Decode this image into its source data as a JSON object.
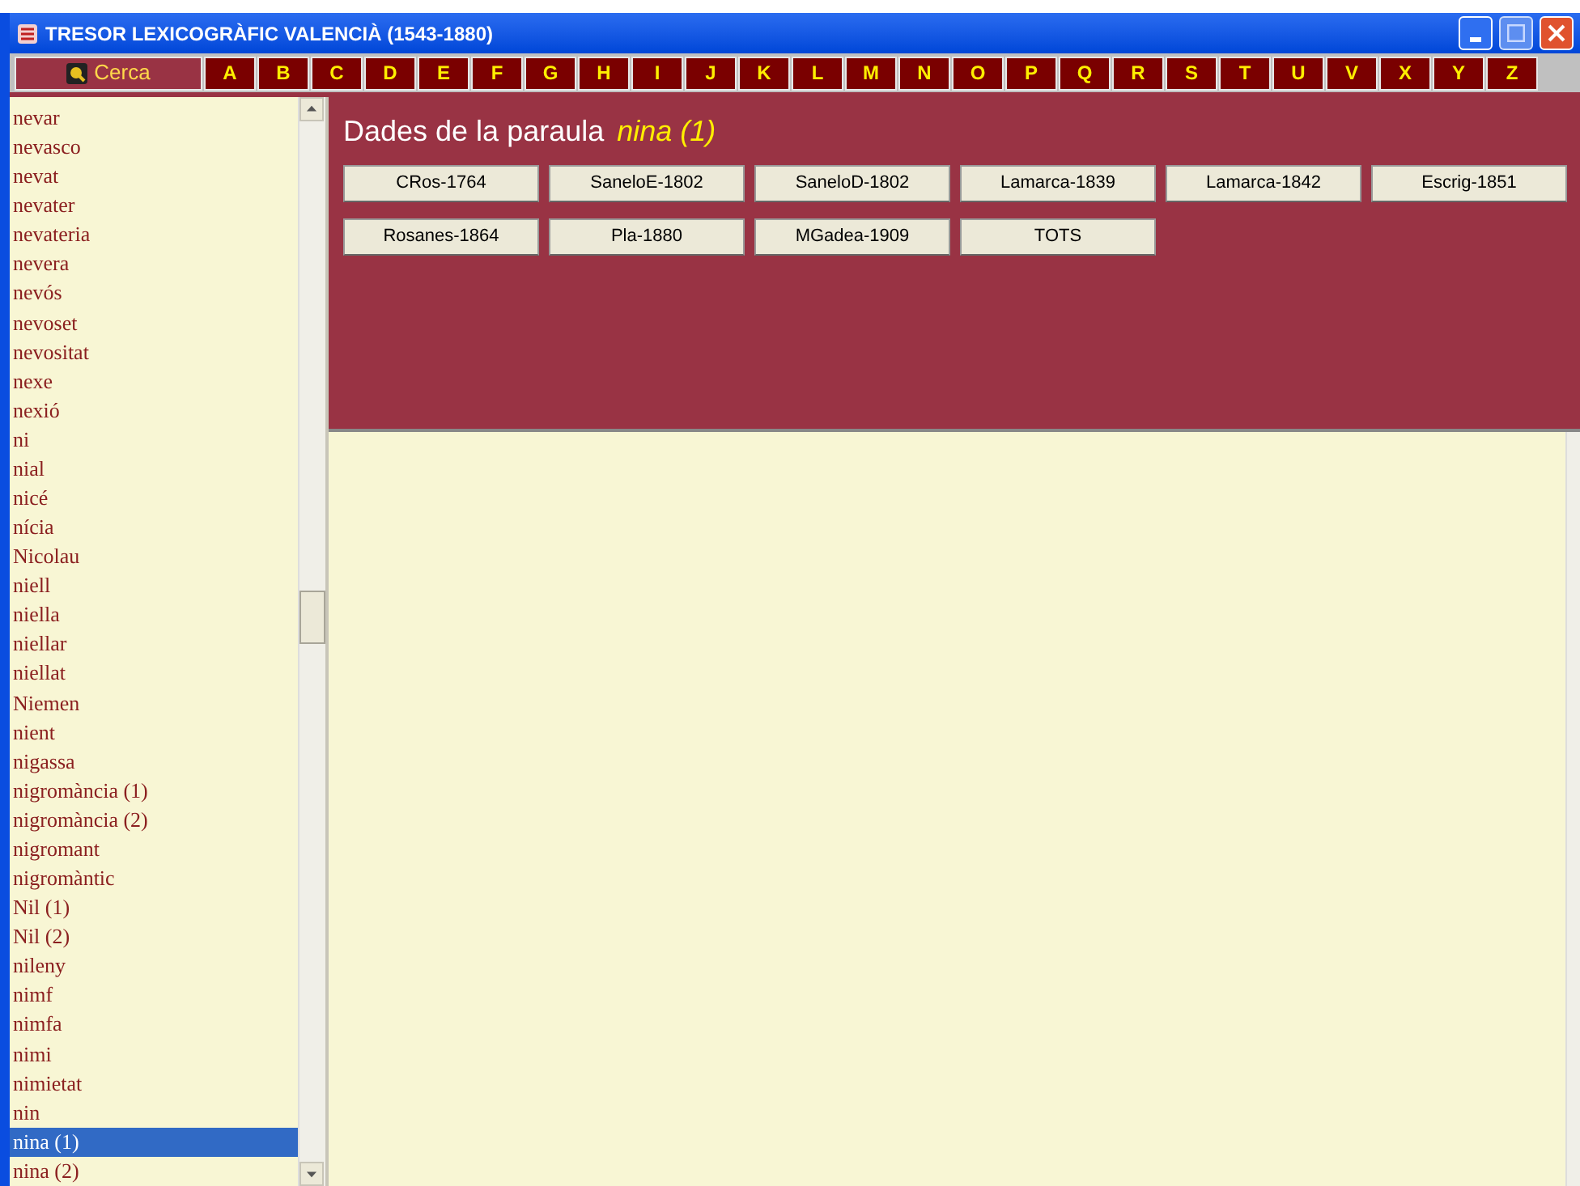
{
  "window": {
    "title": "TRESOR LEXICOGRÀFIC VALENCIÀ (1543-1880)"
  },
  "search_button": {
    "label": "Cerca"
  },
  "letters": [
    "A",
    "B",
    "C",
    "D",
    "E",
    "F",
    "G",
    "H",
    "I",
    "J",
    "K",
    "L",
    "M",
    "N",
    "O",
    "P",
    "Q",
    "R",
    "S",
    "T",
    "U",
    "V",
    "X",
    "Y",
    "Z"
  ],
  "word_list": [
    {
      "label": "nevar",
      "selected": false
    },
    {
      "label": "nevasco",
      "selected": false
    },
    {
      "label": "nevat",
      "selected": false
    },
    {
      "label": "nevater",
      "selected": false
    },
    {
      "label": "nevateria",
      "selected": false
    },
    {
      "label": "nevera",
      "selected": false
    },
    {
      "label": "nevós",
      "selected": false
    },
    {
      "label": "nevoset",
      "selected": false
    },
    {
      "label": "nevositat",
      "selected": false
    },
    {
      "label": "nexe",
      "selected": false
    },
    {
      "label": "nexió",
      "selected": false
    },
    {
      "label": "ni",
      "selected": false
    },
    {
      "label": "nial",
      "selected": false
    },
    {
      "label": "nicé",
      "selected": false
    },
    {
      "label": "nícia",
      "selected": false
    },
    {
      "label": "Nicolau",
      "selected": false
    },
    {
      "label": "niell",
      "selected": false
    },
    {
      "label": "niella",
      "selected": false
    },
    {
      "label": "niellar",
      "selected": false
    },
    {
      "label": "niellat",
      "selected": false
    },
    {
      "label": "Niemen",
      "selected": false
    },
    {
      "label": "nient",
      "selected": false
    },
    {
      "label": "nigassa",
      "selected": false
    },
    {
      "label": "nigromància (1)",
      "selected": false
    },
    {
      "label": "nigromància (2)",
      "selected": false
    },
    {
      "label": "nigromant",
      "selected": false
    },
    {
      "label": "nigromàntic",
      "selected": false
    },
    {
      "label": "Nil (1)",
      "selected": false
    },
    {
      "label": "Nil (2)",
      "selected": false
    },
    {
      "label": "nileny",
      "selected": false
    },
    {
      "label": "nimf",
      "selected": false
    },
    {
      "label": "nimfa",
      "selected": false
    },
    {
      "label": "nimi",
      "selected": false
    },
    {
      "label": "nimietat",
      "selected": false
    },
    {
      "label": "nin",
      "selected": false
    },
    {
      "label": "nina (1)",
      "selected": true
    },
    {
      "label": "nina (2)",
      "selected": false
    }
  ],
  "detail": {
    "heading": "Dades de la paraula",
    "word": "nina (1)",
    "sources": [
      "CRos-1764",
      "SaneloE-1802",
      "SaneloD-1802",
      "Lamarca-1839",
      "Lamarca-1842",
      "Escrig-1851",
      "Rosanes-1864",
      "Pla-1880",
      "MGadea-1909",
      "TOTS"
    ]
  }
}
